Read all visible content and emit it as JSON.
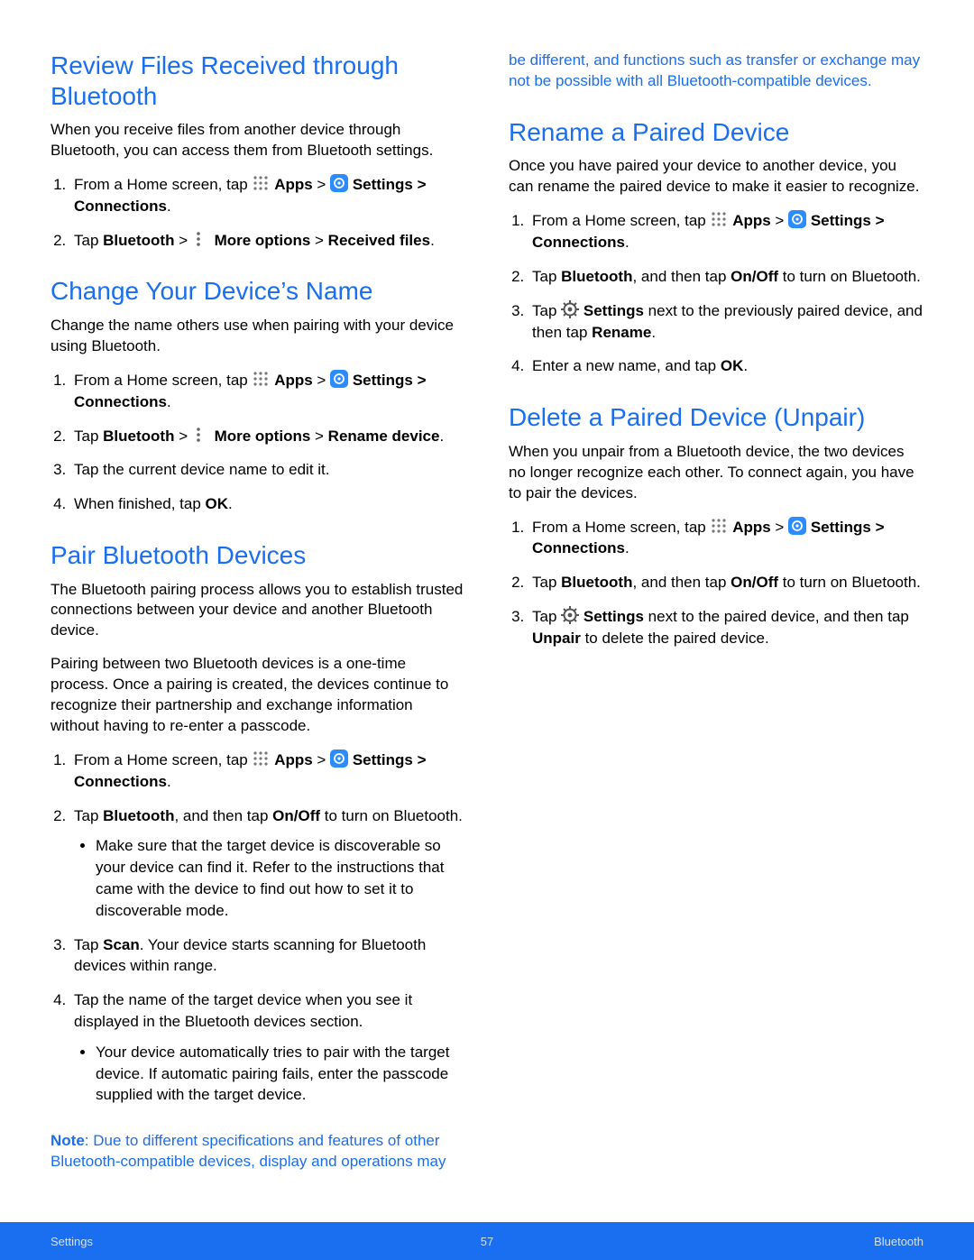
{
  "footer": {
    "left": "Settings",
    "page": "57",
    "right": "Bluetooth"
  },
  "note_label": "Note",
  "icons": {
    "apps": "apps-icon",
    "settings": "settings-icon",
    "more": "more-options-icon",
    "gear": "gear-icon"
  },
  "sections": {
    "review": {
      "heading": "Review Files Received through Bluetooth",
      "intro": "When you receive files from another device through Bluetooth, you can access them from Bluetooth settings.",
      "step1_a": "From a Home screen, tap ",
      "step1_apps": "Apps",
      "step1_gt": " > ",
      "step1_settings": "Settings",
      "step1_tail": " > Connections",
      "step2_a": "Tap ",
      "step2_bt": "Bluetooth",
      "step2_gt": " > ",
      "step2_more": "More options",
      "step2_gt2": " > ",
      "step2_recv": "Received files",
      "period": "."
    },
    "change": {
      "heading": "Change Your Device’s Name",
      "intro": "Change the name others use when pairing with your device using Bluetooth.",
      "step2_a": "Tap ",
      "step2_bt": "Bluetooth",
      "step2_gt": " > ",
      "step2_more": "More options",
      "step2_gt2": " > ",
      "step2_rename": "Rename device",
      "step3": "Tap the current device name to edit it.",
      "step4_a": "When finished, tap ",
      "step4_ok": "OK",
      "period": "."
    },
    "pair": {
      "heading": "Pair Bluetooth Devices",
      "p1": "The Bluetooth pairing process allows you to establish trusted connections between your device and another Bluetooth device.",
      "p2": "Pairing between two Bluetooth devices is a one-time process. Once a pairing is created, the devices continue to recognize their partnership and exchange information without having to re-enter a passcode.",
      "step2_a": "Tap ",
      "step2_bt": "Bluetooth",
      "step2_b": ", and then tap ",
      "step2_onoff": "On/Off",
      "step2_c": " to turn on Bluetooth.",
      "bullet1": "Make sure that the target device is discoverable so your device can find it. Refer to the instructions that came with the device to find out how to set it to discoverable mode.",
      "step3_a": "Tap ",
      "step3_scan": "Scan",
      "step3_b": ". Your device starts scanning for Bluetooth devices within range.",
      "step4": "Tap the name of the target device when you see it displayed in the Bluetooth devices section.",
      "bullet2": "Your device automatically tries to pair with the target device. If automatic pairing fails, enter the passcode supplied with the target device."
    },
    "note_text": ": Due to different specifications and features of other Bluetooth-compatible devices, display and operations may be different, and functions such as transfer or exchange may not be possible with all Bluetooth-compatible devices.",
    "rename": {
      "heading": "Rename a Paired Device",
      "intro": "Once you have paired your device to another device, you can rename the paired device to make it easier to recognize.",
      "step2_a": "Tap ",
      "step2_bt": "Bluetooth",
      "step2_b": ", and then tap ",
      "step2_onoff": "On/Off",
      "step2_c": " to turn on Bluetooth.",
      "step3_a": "Tap ",
      "step3_settings": "Settings",
      "step3_b": " next to the previously paired device, and then tap ",
      "step3_rename": "Rename",
      "step4_a": "Enter a new name, and tap ",
      "step4_ok": "OK",
      "period": "."
    },
    "delete": {
      "heading": "Delete a Paired Device (Unpair)",
      "intro": "When you unpair from a Bluetooth device, the two devices no longer recognize each other. To connect again, you have to pair the devices.",
      "step2_a": "Tap ",
      "step2_bt": "Bluetooth",
      "step2_b": ", and then tap ",
      "step2_onoff": "On/Off",
      "step2_c": " to turn on Bluetooth.",
      "step3_a": "Tap ",
      "step3_settings": "Settings",
      "step3_b": " next to the paired device, and then tap ",
      "step3_unpair": "Unpair",
      "step3_c": " to delete the paired device."
    },
    "common": {
      "from_home": "From a Home screen, tap ",
      "apps": "Apps",
      "gt": " > ",
      "settings": "Settings",
      "conn": " > Connections",
      "period": "."
    }
  }
}
